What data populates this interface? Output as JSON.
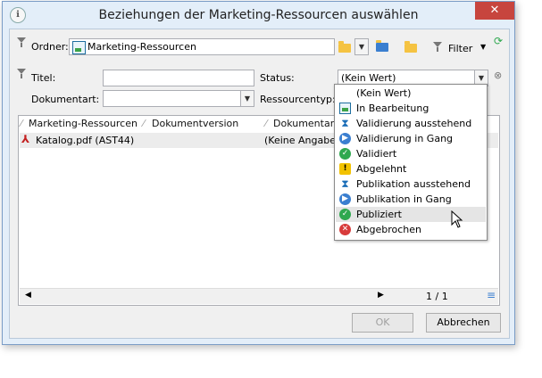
{
  "window": {
    "title": "Beziehungen der Marketing-Ressourcen auswählen",
    "close_glyph": "✕",
    "app_glyph": "ℹ"
  },
  "toolbar": {
    "folder_label": "Ordner:",
    "folder_value": "Marketing-Ressourcen",
    "filter_label": "Filter"
  },
  "filters": {
    "title_label": "Titel:",
    "title_value": "",
    "status_label": "Status:",
    "status_value": "(Kein Wert)",
    "doctype_label": "Dokumentart:",
    "doctype_value": "",
    "restype_label": "Ressourcentyp:"
  },
  "grid": {
    "columns": [
      "Marketing-Ressourcen",
      "Dokumentversion",
      "Dokumentart"
    ],
    "rows": [
      {
        "name": "Katalog.pdf (AST44)",
        "version": "(Keine Angabe)"
      }
    ],
    "pager": "1 / 1"
  },
  "status_options": [
    {
      "label": "(Kein Wert)",
      "icon": "none"
    },
    {
      "label": "In Bearbeitung",
      "icon": "chart-icon"
    },
    {
      "label": "Validierung ausstehend",
      "icon": "hourglass-icon"
    },
    {
      "label": "Validierung in Gang",
      "icon": "play-icon"
    },
    {
      "label": "Validiert",
      "icon": "check-icon"
    },
    {
      "label": "Abgelehnt",
      "icon": "warning-icon"
    },
    {
      "label": "Publikation ausstehend",
      "icon": "hourglass-icon"
    },
    {
      "label": "Publikation in Gang",
      "icon": "play-icon"
    },
    {
      "label": "Publiziert",
      "icon": "check-icon",
      "hovered": true
    },
    {
      "label": "Abgebrochen",
      "icon": "cancel-icon"
    }
  ],
  "buttons": {
    "ok": "OK",
    "cancel": "Abbrechen"
  },
  "colors": {
    "title_bg": "#e3eef9",
    "close": "#c7453e",
    "hover_row": "#e5e5e5"
  }
}
